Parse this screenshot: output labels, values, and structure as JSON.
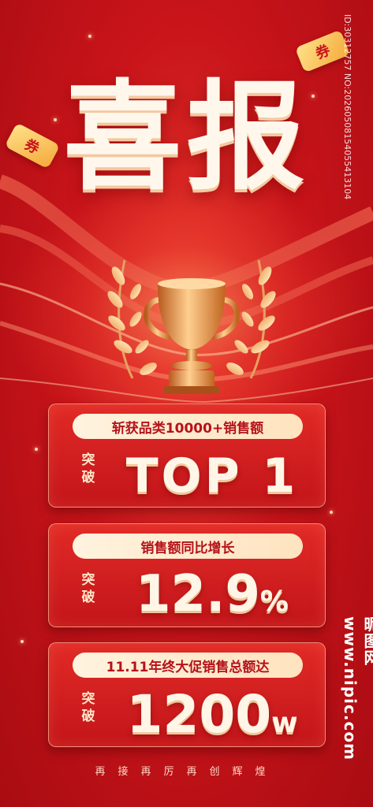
{
  "title": "喜报",
  "coupon_text": "券",
  "cards": [
    {
      "pill": "斩获品类10000+销售额",
      "label": "突破",
      "value": "TOP 1"
    },
    {
      "pill": "销售额同比增长",
      "label": "突破",
      "value": "12.9",
      "unit": "%"
    },
    {
      "pill": "11.11年终大促销售总额达",
      "label": "突破",
      "value": "1200",
      "unit": "w"
    }
  ],
  "footer": "再接再厉再创辉煌",
  "watermark": {
    "id_text": "ID:30312757 NO:20260508154055413104",
    "brand": "昵图网 www.nipic.com"
  },
  "colors": {
    "background": "#c8141a",
    "gold": "#f4a93b",
    "cream": "#fff6e8"
  }
}
